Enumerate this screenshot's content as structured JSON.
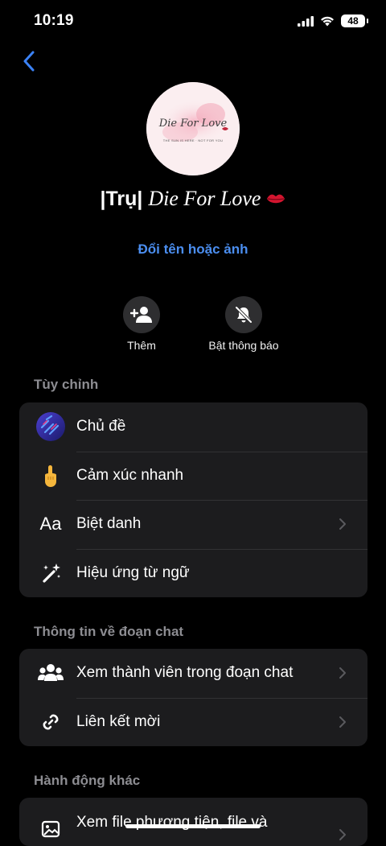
{
  "status": {
    "time": "10:19",
    "battery": "48"
  },
  "profile": {
    "avatar_text": "Die For Love",
    "avatar_tagline": "THE SUN IS HERE · NOT FOR YOU",
    "name_prefix": "|Trụ|",
    "name_script": "Die For Love",
    "rename_label": "Đổi tên hoặc ảnh"
  },
  "actions": [
    {
      "label": "Thêm",
      "icon": "add-person-icon"
    },
    {
      "label": "Bật thông báo",
      "icon": "bell-muted-icon"
    }
  ],
  "customize": {
    "title": "Tùy chỉnh",
    "items": [
      {
        "label": "Chủ đề",
        "icon": "theme-icon"
      },
      {
        "label": "Cảm xúc nhanh",
        "icon": "quick-reaction-icon"
      },
      {
        "label": "Biệt danh",
        "icon": "nickname-icon",
        "icon_text": "Aa"
      },
      {
        "label": "Hiệu ứng từ ngữ",
        "icon": "magic-wand-icon"
      }
    ]
  },
  "chat_info": {
    "title": "Thông tin về đoạn chat",
    "items": [
      {
        "label": "Xem thành viên trong đoạn chat",
        "icon": "people-icon"
      },
      {
        "label": "Liên kết mời",
        "icon": "link-icon"
      }
    ]
  },
  "other_actions": {
    "title": "Hành động khác",
    "items": [
      {
        "label": "Xem file phương tiện, file và",
        "icon": "media-icon"
      }
    ]
  },
  "colors": {
    "accent": "#4b8ef0",
    "card": "#1c1c1e",
    "background": "#000000"
  }
}
